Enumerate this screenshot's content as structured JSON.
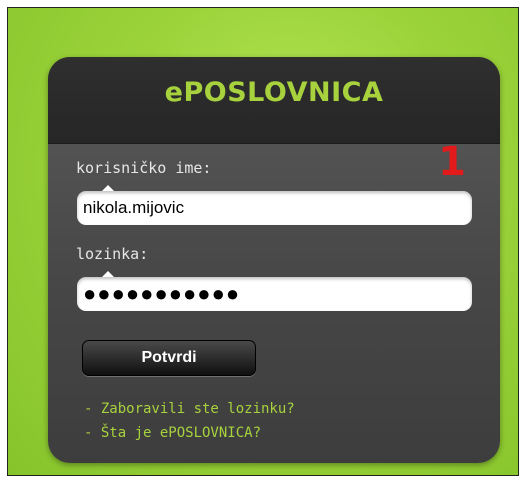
{
  "app": {
    "title": "ePOSLOVNICA"
  },
  "form": {
    "username_label": "korisničko ime:",
    "username_value": "nikola.mijovic",
    "password_label": "lozinka:",
    "password_value": "●●●●●●●●●●●",
    "submit_label": "Potvrdi",
    "step_marker": "1"
  },
  "links": {
    "forgot_password": "- Zaboravili ste lozinku?",
    "about": "- Šta je ePOSLOVNICA?"
  },
  "colors": {
    "background_green": "#9cd33a",
    "accent_green": "#a7d23d",
    "panel_dark": "#474747",
    "marker_red": "#e11b1b"
  }
}
